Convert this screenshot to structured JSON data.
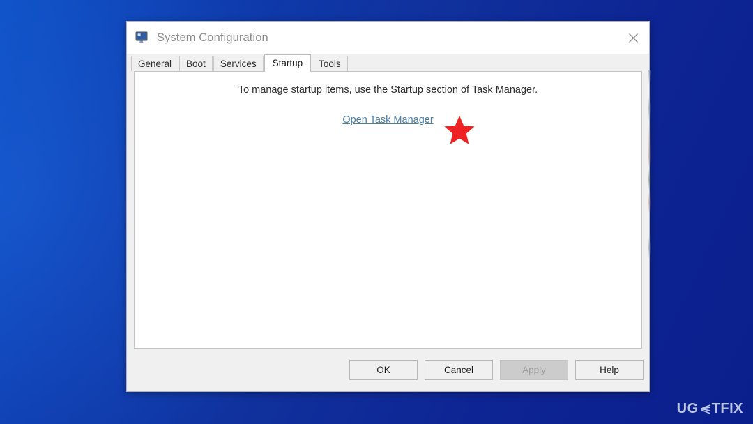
{
  "window": {
    "title": "System Configuration",
    "icon": "system-configuration-icon",
    "close_label": "×"
  },
  "tabs": [
    {
      "label": "General",
      "active": false
    },
    {
      "label": "Boot",
      "active": false
    },
    {
      "label": "Services",
      "active": false
    },
    {
      "label": "Startup",
      "active": true
    },
    {
      "label": "Tools",
      "active": false
    }
  ],
  "panel": {
    "message": "To manage startup items, use the Startup section of Task Manager.",
    "link_label": "Open Task Manager",
    "link_color": "#4a7fa8"
  },
  "annotation": {
    "shape": "star",
    "color": "#ee2222"
  },
  "footer": {
    "buttons": [
      {
        "label": "OK",
        "disabled": false
      },
      {
        "label": "Cancel",
        "disabled": false
      },
      {
        "label": "Apply",
        "disabled": true
      },
      {
        "label": "Help",
        "disabled": false
      }
    ]
  },
  "watermark": {
    "prefix": "UG",
    "suffix": "TFIX"
  },
  "theme": {
    "desktop_blue": "#10309c",
    "dialog_bg": "#f0f0f0",
    "panel_bg": "#ffffff",
    "title_text": "#8c8c8c"
  }
}
